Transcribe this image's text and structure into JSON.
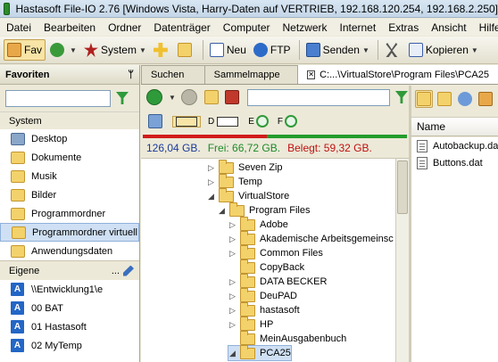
{
  "title": "Hastasoft File-IO 2.76  [Windows Vista, Harry-Daten auf VERTRIEB, 192.168.120.254, 192.168.2.250]",
  "menu": [
    "Datei",
    "Bearbeiten",
    "Ordner",
    "Datenträger",
    "Computer",
    "Netzwerk",
    "Internet",
    "Extras",
    "Ansicht",
    "Hilfe"
  ],
  "toolbar": {
    "fav": "Fav",
    "system": "System",
    "neu": "Neu",
    "ftp": "FTP",
    "senden": "Senden",
    "kopieren": "Kopieren"
  },
  "left_panel": {
    "header": "Favoriten",
    "pin": "ᛘ",
    "system_label": "System",
    "system_items": [
      {
        "label": "Desktop",
        "icon": "desktop-icon"
      },
      {
        "label": "Dokumente",
        "icon": "documents-icon"
      },
      {
        "label": "Musik",
        "icon": "music-icon"
      },
      {
        "label": "Bilder",
        "icon": "pictures-icon"
      },
      {
        "label": "Programmordner",
        "icon": "program-folder-icon"
      },
      {
        "label": "Programmordner virtuell",
        "icon": "virtual-folder-icon"
      },
      {
        "label": "Anwendungsdaten",
        "icon": "appdata-icon"
      }
    ],
    "eigene_label": "Eigene",
    "eigene_more": "...",
    "eigene_items": [
      {
        "letter": "A",
        "label": "\\\\Entwicklung1\\e"
      },
      {
        "letter": "A",
        "label": "00 BAT"
      },
      {
        "letter": "A",
        "label": "01 Hastasoft"
      },
      {
        "letter": "A",
        "label": "02 MyTemp"
      }
    ]
  },
  "tabs": [
    {
      "label": "Suchen"
    },
    {
      "label": "Sammelmappe"
    },
    {
      "label": "C:...\\VirtualStore\\Program Files\\PCA25"
    }
  ],
  "drive_letters": {
    "d": "D",
    "e": "E",
    "f": "F"
  },
  "stats": {
    "total": "126,04 GB.",
    "free": "Frei: 66,72 GB.",
    "used": "Belegt: 59,32 GB.",
    "used_fraction": 0.47
  },
  "tree": [
    {
      "label": "Seven Zip",
      "toggle": "▷",
      "indent": 1
    },
    {
      "label": "Temp",
      "toggle": "▷",
      "indent": 1
    },
    {
      "label": "VirtualStore",
      "toggle": "◢",
      "indent": 1
    },
    {
      "label": "Program Files",
      "toggle": "◢",
      "indent": 2
    },
    {
      "label": "Adobe",
      "toggle": "▷",
      "indent": 3
    },
    {
      "label": "Akademische Arbeitsgemeinsc",
      "toggle": "▷",
      "indent": 3
    },
    {
      "label": "Common Files",
      "toggle": "▷",
      "indent": 3
    },
    {
      "label": "CopyBack",
      "toggle": "",
      "indent": 3
    },
    {
      "label": "DATA BECKER",
      "toggle": "▷",
      "indent": 3
    },
    {
      "label": "DeuPAD",
      "toggle": "▷",
      "indent": 3
    },
    {
      "label": "hastasoft",
      "toggle": "▷",
      "indent": 3
    },
    {
      "label": "HP",
      "toggle": "▷",
      "indent": 3
    },
    {
      "label": "MeinAusgabenbuch",
      "toggle": "",
      "indent": 3
    },
    {
      "label": "PCA25",
      "toggle": "◢",
      "indent": 3,
      "selected": true
    }
  ],
  "file_list": {
    "column": "Name",
    "files": [
      "Autobackup.dat",
      "Buttons.dat"
    ]
  },
  "colors": {
    "accent": "#2366c6",
    "free": "#229c2b",
    "used": "#d21b1b",
    "folder": "#f3d26b"
  }
}
